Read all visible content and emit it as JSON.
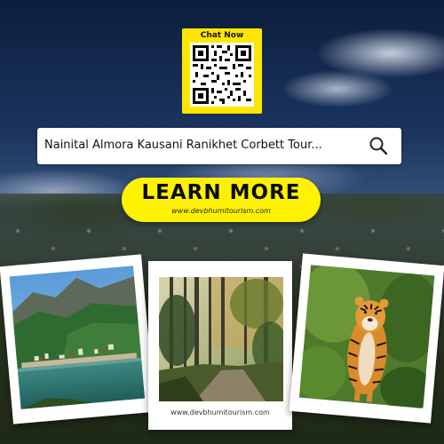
{
  "qr": {
    "title": "Chat Now",
    "icon": "qr-code-icon",
    "color": "#ffe600"
  },
  "search": {
    "text": "Nainital Almora Kausani Ranikhet Corbett Tour...",
    "icon": "search-icon"
  },
  "cta": {
    "label": "LEARN MORE",
    "url": "www.devbhumitourism.com",
    "color": "#fff200"
  },
  "photos": {
    "lake": "lake-town-photo",
    "forest": "forest-path-photo",
    "tiger": "tiger-photo",
    "caption": "www.devbhumitourism.com"
  }
}
